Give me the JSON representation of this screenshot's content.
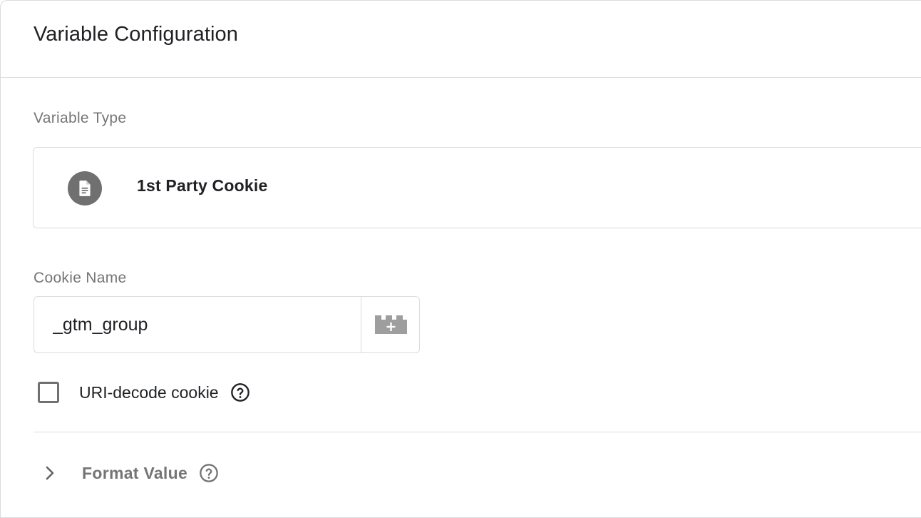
{
  "header": {
    "title": "Variable Configuration"
  },
  "variable_type": {
    "section_label": "Variable Type",
    "name": "1st Party Cookie",
    "icon": "document-icon"
  },
  "cookie_name": {
    "label": "Cookie Name",
    "value": "_gtm_group",
    "picker_icon": "variable-picker-icon"
  },
  "uri_decode": {
    "label": "URI-decode cookie",
    "checked": false,
    "help_icon": "help-circle-icon"
  },
  "format_value": {
    "label": "Format Value",
    "expanded": false,
    "expand_icon": "chevron-right-icon",
    "help_icon": "help-circle-icon"
  },
  "colors": {
    "icon_fill": "#707070",
    "border": "#dadce0",
    "muted_text": "#757575"
  }
}
